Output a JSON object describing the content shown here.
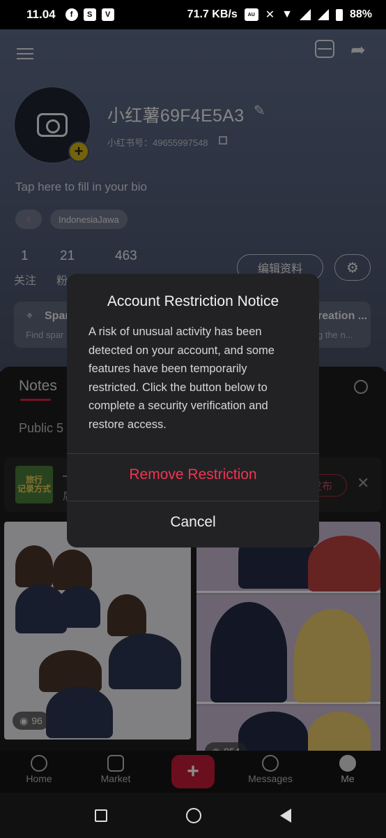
{
  "status_bar": {
    "time": "11.04",
    "net_speed": "71.7 KB/s",
    "battery": "88%"
  },
  "profile": {
    "username": "小红薯69F4E5A3",
    "id_text": "小红书号：49655997548",
    "bio_placeholder": "Tap here to fill in your bio",
    "gender_symbol": "♀",
    "location": "IndonesiaJawa",
    "stats": [
      {
        "value": "1",
        "label": "关注"
      },
      {
        "value": "21",
        "label": "粉"
      },
      {
        "value": "463",
        "label": ""
      }
    ],
    "edit_profile_label": "编辑资料",
    "cards": [
      {
        "title": "Spar",
        "subtitle": "Find spar"
      },
      {
        "title": "reation ...",
        "subtitle": "g the n..."
      }
    ]
  },
  "content": {
    "tab_notes": "Notes",
    "public_label": "Public 5",
    "draft": {
      "thumb_text": "旅行\n记录方式",
      "publish_label": "发布",
      "first_char": "—",
      "second_char": "后"
    },
    "tiles": [
      {
        "views": "96"
      },
      {
        "views": "954"
      }
    ]
  },
  "bottom_nav": {
    "items": [
      {
        "label": "Home",
        "icon": "home-icon"
      },
      {
        "label": "Market",
        "icon": "market-icon"
      },
      {
        "label": "+",
        "icon": "plus-icon"
      },
      {
        "label": "Messages",
        "icon": "messages-icon"
      },
      {
        "label": "Me",
        "icon": "me-icon"
      }
    ]
  },
  "dialog": {
    "title": "Account Restriction Notice",
    "body": "A risk of unusual activity has been detected on your account, and some features have been temporarily restricted. Click the button below to complete a security verification and restore access.",
    "primary_label": "Remove Restriction",
    "cancel_label": "Cancel"
  },
  "colors": {
    "accent": "#ef3552",
    "brand_red": "#c41a36"
  }
}
